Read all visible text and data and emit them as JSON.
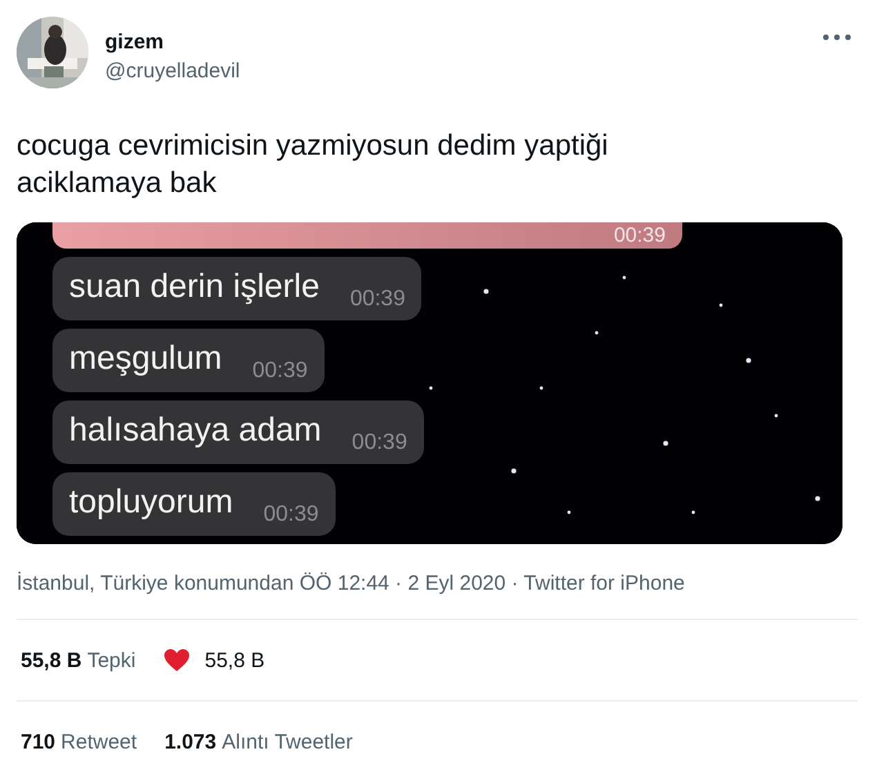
{
  "author": {
    "name": "gizem",
    "handle": "@cruyelladevil"
  },
  "text": "cocuga cevrimicisin yazmiyosun dedim yaptiği aciklamaya bak",
  "media": {
    "top_bubble_time": "00:39",
    "messages": [
      {
        "text": "suan derin işlerle",
        "time": "00:39"
      },
      {
        "text": "meşgulum",
        "time": "00:39"
      },
      {
        "text": "halısahaya adam",
        "time": "00:39"
      },
      {
        "text": "topluyorum",
        "time": "00:39"
      }
    ]
  },
  "meta": "İstanbul, Türkiye konumundan ÖÖ 12:44 · 2 Eyl 2020 · Twitter for iPhone",
  "reactions": {
    "count": "55,8 B",
    "label": "Tepki",
    "heart_count": "55,8 B"
  },
  "stats": [
    {
      "count": "710",
      "label": "Retweet"
    },
    {
      "count": "1.073",
      "label": "Alıntı Tweetler"
    }
  ]
}
